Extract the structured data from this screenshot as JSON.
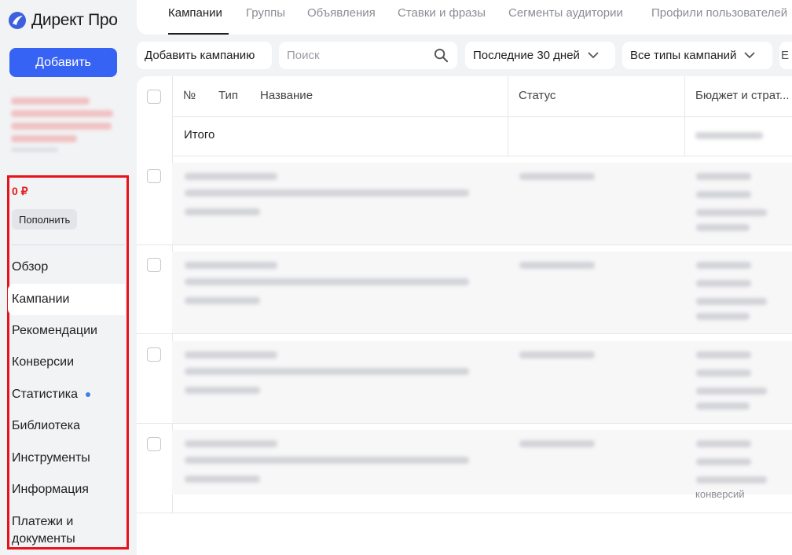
{
  "app": {
    "title": "Директ Про"
  },
  "sidebar": {
    "add_label": "Добавить",
    "balance": "0 ₽",
    "topup_label": "Пополнить",
    "items": [
      {
        "label": "Обзор",
        "active": false
      },
      {
        "label": "Кампании",
        "active": true
      },
      {
        "label": "Рекомендации",
        "active": false
      },
      {
        "label": "Конверсии",
        "active": false
      },
      {
        "label": "Статистика",
        "active": false,
        "dot": true
      },
      {
        "label": "Библиотека",
        "active": false
      },
      {
        "label": "Инструменты",
        "active": false
      },
      {
        "label": "Информация",
        "active": false
      },
      {
        "label": "Платежи и документы",
        "active": false
      }
    ]
  },
  "tabs": [
    {
      "label": "Кампании",
      "active": true
    },
    {
      "label": "Группы"
    },
    {
      "label": "Объявления"
    },
    {
      "label": "Ставки и фразы"
    },
    {
      "label": "Сегменты аудитории"
    },
    {
      "label": "Профили пользователей"
    }
  ],
  "filters": {
    "add_campaign_label": "Добавить кампанию",
    "search_placeholder": "Поиск",
    "period": "Последние 30 дней",
    "campaign_types": "Все типы кампаний"
  },
  "table": {
    "columns": {
      "number": "№",
      "type": "Тип",
      "name": "Название",
      "status": "Статус",
      "budget": "Бюджет и страт..."
    },
    "total_label": "Итого",
    "partial_text": "конверсий"
  },
  "colors": {
    "accent": "#3763f4",
    "highlight_border": "#e8121b",
    "balance": "#e0201f",
    "dot": "#3d7ef0"
  }
}
